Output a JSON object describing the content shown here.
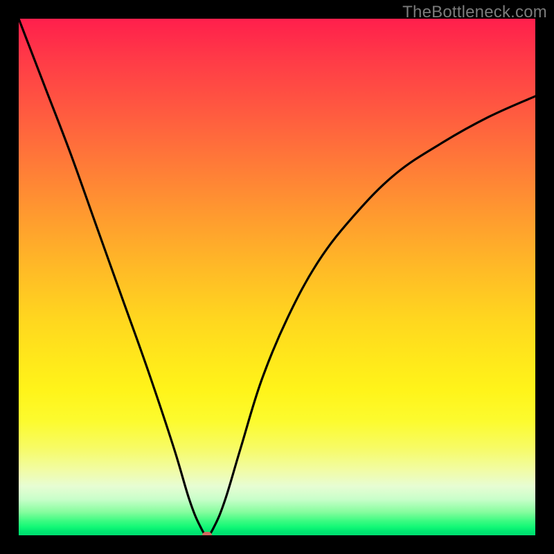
{
  "watermark": "TheBottleneck.com",
  "chart_data": {
    "type": "line",
    "title": "",
    "xlabel": "",
    "ylabel": "",
    "xlim": [
      0,
      100
    ],
    "ylim": [
      0,
      100
    ],
    "grid": false,
    "legend": false,
    "series": [
      {
        "name": "curve",
        "x": [
          0,
          5,
          10,
          15,
          20,
          25,
          30,
          33,
          35,
          36.5,
          38,
          40,
          43,
          47,
          52,
          58,
          65,
          73,
          82,
          91,
          100
        ],
        "values": [
          100,
          87,
          74,
          60,
          46,
          32,
          17,
          7,
          2,
          0,
          2,
          7,
          17,
          30,
          42,
          53,
          62,
          70,
          76,
          81,
          85
        ]
      }
    ],
    "marker": {
      "x": 36.5,
      "y": 0
    },
    "background_gradient": {
      "top": "#ff1f4c",
      "mid": "#ffe81b",
      "bottom": "#00dd70"
    }
  }
}
